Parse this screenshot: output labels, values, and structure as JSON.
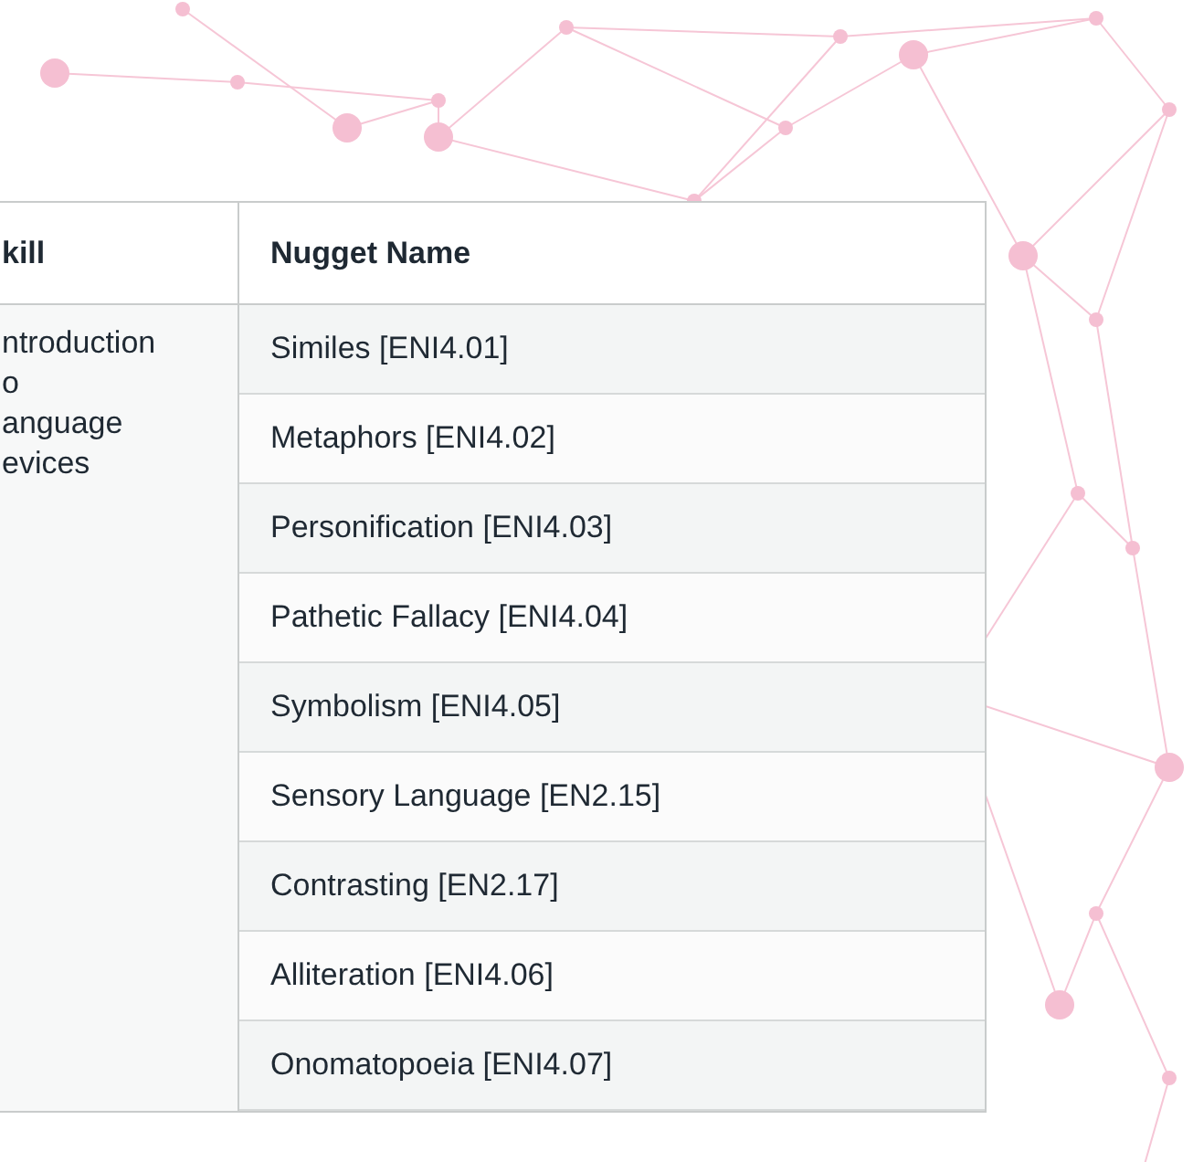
{
  "table": {
    "columns": [
      "kill",
      "Nugget Name"
    ],
    "skill_cell": [
      "ntroduction",
      "o",
      "anguage",
      "evices"
    ],
    "rows": [
      {
        "nugget": "Similes [ENI4.01]"
      },
      {
        "nugget": "Metaphors [ENI4.02]"
      },
      {
        "nugget": "Personification [ENI4.03]"
      },
      {
        "nugget": "Pathetic Fallacy [ENI4.04]"
      },
      {
        "nugget": "Symbolism [ENI4.05]"
      },
      {
        "nugget": "Sensory Language [EN2.15]"
      },
      {
        "nugget": "Contrasting [EN2.17]"
      },
      {
        "nugget": "Alliteration [ENI4.06]"
      },
      {
        "nugget": "Onomatopoeia [ENI4.07]"
      }
    ]
  }
}
